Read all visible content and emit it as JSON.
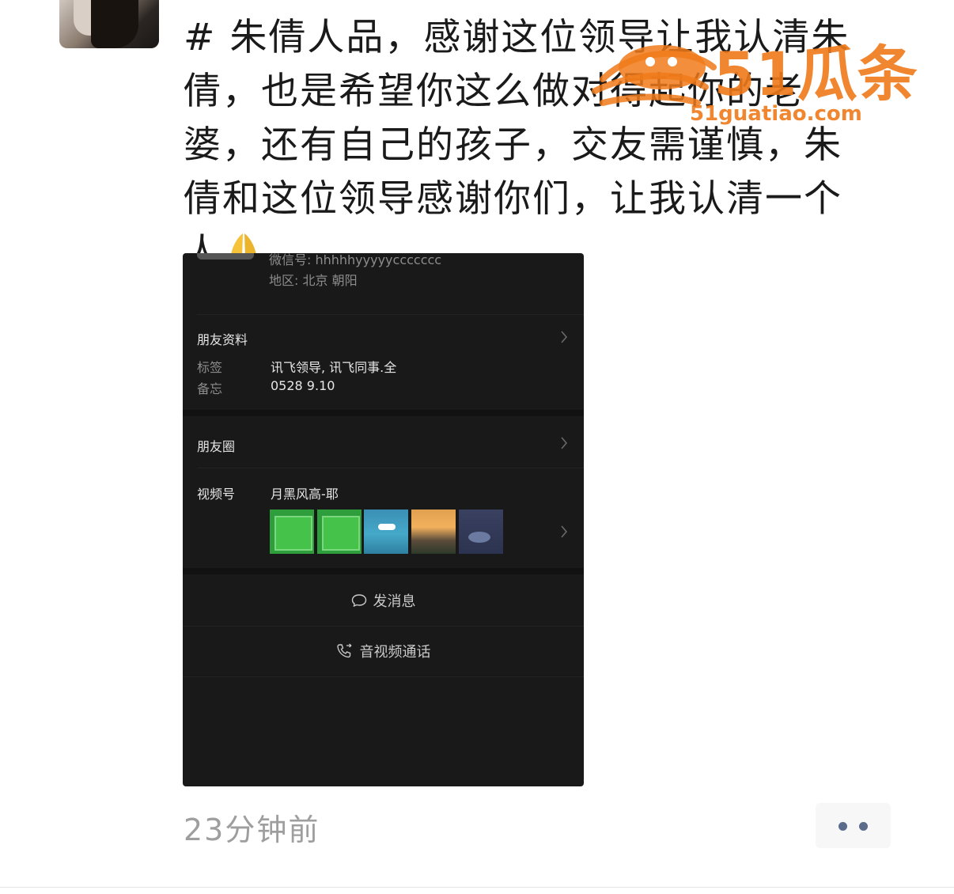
{
  "post": {
    "text": "# 朱倩人品，感谢这位领导让我认清朱倩，也是希望你这么做对得起你的老婆，还有自己的孩子，交友需谨慎，朱倩和这位领导感谢你们，让我认清一个人",
    "emoji": "folded-hands-emoji",
    "timestamp": "23分钟前"
  },
  "watermark": {
    "brand": "51瓜条",
    "domain": "51guatiao.com"
  },
  "screenshot": {
    "wechat_id": "微信号: hhhhhyyyyyccccccc",
    "region": "地区: 北京 朝阳",
    "friend_info_label": "朋友资料",
    "tag_label": "标签",
    "tag_value": "讯飞领导, 讯飞同事.全",
    "note_label": "备忘",
    "note_value": "0528   9.10",
    "moments_label": "朋友圈",
    "channels_label": "视频号",
    "channels_name": "月黑风高-耶",
    "send_message": "发消息",
    "video_call": "音视频通话"
  },
  "colors": {
    "text": "#1a1a1a",
    "timestamp": "#9e9e9e",
    "screenshot_bg": "#191919",
    "more_dots": "#5b6b8c",
    "watermark": "#f07a1a"
  }
}
